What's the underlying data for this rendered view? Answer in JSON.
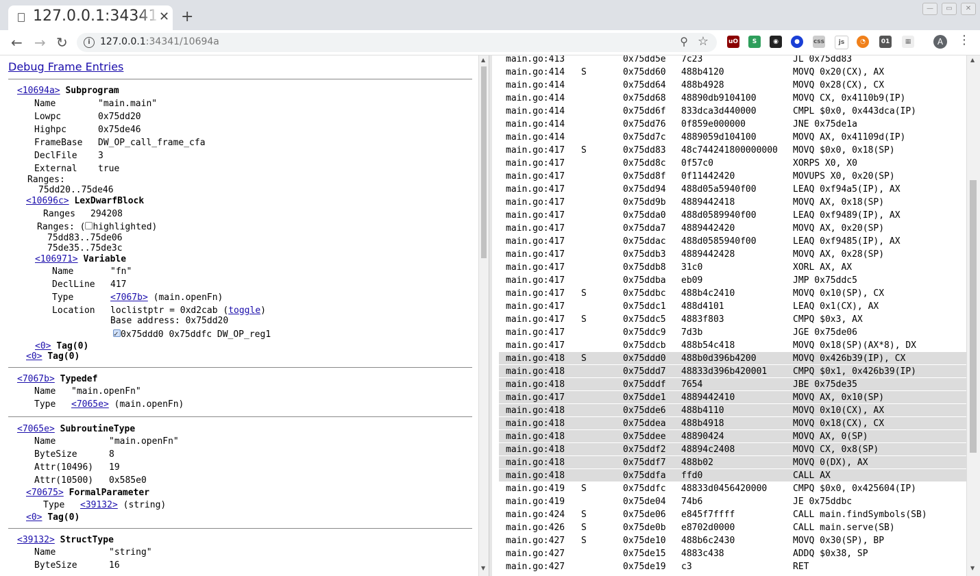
{
  "browser": {
    "tab_title": "127.0.0.1:34341/",
    "url_host": "127.0.0.1",
    "url_rest": ":34341/10694a",
    "new_tab": "+",
    "close": "✕",
    "avatar": "A"
  },
  "left": {
    "heading": "Debug Frame Entries",
    "subprogram": {
      "ref": "<10694a>",
      "kind": "Subprogram",
      "attrs": [
        [
          "Name",
          "\"main.main\""
        ],
        [
          "Lowpc",
          "0x75dd20"
        ],
        [
          "Highpc",
          "0x75de46"
        ],
        [
          "FrameBase",
          "DW_OP_call_frame_cfa"
        ],
        [
          "DeclFile",
          "3"
        ],
        [
          "External",
          "true"
        ]
      ],
      "ranges_label": "Ranges:",
      "range": "75dd20..75de46"
    },
    "lexblock": {
      "ref": "<10696c>",
      "kind": "LexDwarfBlock",
      "ranges_attr": "Ranges",
      "ranges_value": "294208",
      "ranges_label": "Ranges: (",
      "highlighted": "highlighted)",
      "range1": "75dd83..75de06",
      "range2": "75de35..75de3c"
    },
    "variable": {
      "ref": "<106971>",
      "kind": "Variable",
      "name_k": "Name",
      "name_v": "\"fn\"",
      "declline_k": "DeclLine",
      "declline_v": "417",
      "type_k": "Type",
      "type_ref": "<7067b>",
      "type_v": "(main.openFn)",
      "loc_k": "Location",
      "loc_v": "loclistptr = 0xd2cab (",
      "loc_toggle": "toggle",
      "loc_close": ")",
      "base": "Base address: 0x75dd20",
      "entry": "0x75ddd0 0x75ddfc DW_OP_reg1"
    },
    "tag0": "<0>",
    "tag0_text": "Tag(0)",
    "typedef": {
      "ref": "<7067b>",
      "kind": "Typedef",
      "name_k": "Name",
      "name_v": "\"main.openFn\"",
      "type_k": "Type",
      "type_ref": "<7065e>",
      "type_v": "(main.openFn)"
    },
    "subroutine": {
      "ref": "<7065e>",
      "kind": "SubroutineType",
      "attrs": [
        [
          "Name",
          "\"main.openFn\""
        ],
        [
          "ByteSize",
          "8"
        ],
        [
          "Attr(10496)",
          "19"
        ],
        [
          "Attr(10500)",
          "0x585e0"
        ]
      ],
      "param_ref": "<70675>",
      "param_kind": "FormalParameter",
      "param_type_k": "Type",
      "param_type_ref": "<39132>",
      "param_type_v": "(string)"
    },
    "structtype": {
      "ref": "<39132>",
      "kind": "StructType",
      "name_k": "Name",
      "name_v": "\"string\"",
      "bytesize_k": "ByteSize",
      "bytesize_v": "16"
    }
  },
  "disasm": [
    [
      "main.go:413",
      "",
      "0x75dd5e",
      "7c23",
      "JL 0x75dd83",
      false
    ],
    [
      "main.go:414",
      "S",
      "0x75dd60",
      "488b4120",
      "MOVQ 0x20(CX), AX",
      false
    ],
    [
      "main.go:414",
      "",
      "0x75dd64",
      "488b4928",
      "MOVQ 0x28(CX), CX",
      false
    ],
    [
      "main.go:414",
      "",
      "0x75dd68",
      "48890db9104100",
      "MOVQ CX, 0x4110b9(IP)",
      false
    ],
    [
      "main.go:414",
      "",
      "0x75dd6f",
      "833dca3d440000",
      "CMPL $0x0, 0x443dca(IP)",
      false
    ],
    [
      "main.go:414",
      "",
      "0x75dd76",
      "0f859e000000",
      "JNE 0x75de1a",
      false
    ],
    [
      "main.go:414",
      "",
      "0x75dd7c",
      "4889059d104100",
      "MOVQ AX, 0x41109d(IP)",
      false
    ],
    [
      "main.go:417",
      "S",
      "0x75dd83",
      "48c744241800000000",
      "MOVQ $0x0, 0x18(SP)",
      false
    ],
    [
      "main.go:417",
      "",
      "0x75dd8c",
      "0f57c0",
      "XORPS X0, X0",
      false
    ],
    [
      "main.go:417",
      "",
      "0x75dd8f",
      "0f11442420",
      "MOVUPS X0, 0x20(SP)",
      false
    ],
    [
      "main.go:417",
      "",
      "0x75dd94",
      "488d05a5940f00",
      "LEAQ 0xf94a5(IP), AX",
      false
    ],
    [
      "main.go:417",
      "",
      "0x75dd9b",
      "4889442418",
      "MOVQ AX, 0x18(SP)",
      false
    ],
    [
      "main.go:417",
      "",
      "0x75dda0",
      "488d0589940f00",
      "LEAQ 0xf9489(IP), AX",
      false
    ],
    [
      "main.go:417",
      "",
      "0x75dda7",
      "4889442420",
      "MOVQ AX, 0x20(SP)",
      false
    ],
    [
      "main.go:417",
      "",
      "0x75ddac",
      "488d0585940f00",
      "LEAQ 0xf9485(IP), AX",
      false
    ],
    [
      "main.go:417",
      "",
      "0x75ddb3",
      "4889442428",
      "MOVQ AX, 0x28(SP)",
      false
    ],
    [
      "main.go:417",
      "",
      "0x75ddb8",
      "31c0",
      "XORL AX, AX",
      false
    ],
    [
      "main.go:417",
      "",
      "0x75ddba",
      "eb09",
      "JMP 0x75ddc5",
      false
    ],
    [
      "main.go:417",
      "S",
      "0x75ddbc",
      "488b4c2410",
      "MOVQ 0x10(SP), CX",
      false
    ],
    [
      "main.go:417",
      "",
      "0x75ddc1",
      "488d4101",
      "LEAQ 0x1(CX), AX",
      false
    ],
    [
      "main.go:417",
      "S",
      "0x75ddc5",
      "4883f803",
      "CMPQ $0x3, AX",
      false
    ],
    [
      "main.go:417",
      "",
      "0x75ddc9",
      "7d3b",
      "JGE 0x75de06",
      false
    ],
    [
      "main.go:417",
      "",
      "0x75ddcb",
      "488b54c418",
      "MOVQ 0x18(SP)(AX*8), DX",
      false
    ],
    [
      "main.go:418",
      "S",
      "0x75ddd0",
      "488b0d396b4200",
      "MOVQ 0x426b39(IP), CX",
      true
    ],
    [
      "main.go:418",
      "",
      "0x75ddd7",
      "48833d396b420001",
      "CMPQ $0x1, 0x426b39(IP)",
      true
    ],
    [
      "main.go:418",
      "",
      "0x75dddf",
      "7654",
      "JBE 0x75de35",
      true
    ],
    [
      "main.go:417",
      "",
      "0x75dde1",
      "4889442410",
      "MOVQ AX, 0x10(SP)",
      true
    ],
    [
      "main.go:418",
      "",
      "0x75dde6",
      "488b4110",
      "MOVQ 0x10(CX), AX",
      true
    ],
    [
      "main.go:418",
      "",
      "0x75ddea",
      "488b4918",
      "MOVQ 0x18(CX), CX",
      true
    ],
    [
      "main.go:418",
      "",
      "0x75ddee",
      "48890424",
      "MOVQ AX, 0(SP)",
      true
    ],
    [
      "main.go:418",
      "",
      "0x75ddf2",
      "48894c2408",
      "MOVQ CX, 0x8(SP)",
      true
    ],
    [
      "main.go:418",
      "",
      "0x75ddf7",
      "488b02",
      "MOVQ 0(DX), AX",
      true
    ],
    [
      "main.go:418",
      "",
      "0x75ddfa",
      "ffd0",
      "CALL AX",
      true
    ],
    [
      "main.go:419",
      "S",
      "0x75ddfc",
      "48833d0456420000",
      "CMPQ $0x0, 0x425604(IP)",
      false
    ],
    [
      "main.go:419",
      "",
      "0x75de04",
      "74b6",
      "JE 0x75ddbc",
      false
    ],
    [
      "main.go:424",
      "S",
      "0x75de06",
      "e845f7ffff",
      "CALL main.findSymbols(SB)",
      false
    ],
    [
      "main.go:426",
      "S",
      "0x75de0b",
      "e8702d0000",
      "CALL main.serve(SB)",
      false
    ],
    [
      "main.go:427",
      "S",
      "0x75de10",
      "488b6c2430",
      "MOVQ 0x30(SP), BP",
      false
    ],
    [
      "main.go:427",
      "",
      "0x75de15",
      "4883c438",
      "ADDQ $0x38, SP",
      false
    ],
    [
      "main.go:427",
      "",
      "0x75de19",
      "c3",
      "RET",
      false
    ]
  ]
}
